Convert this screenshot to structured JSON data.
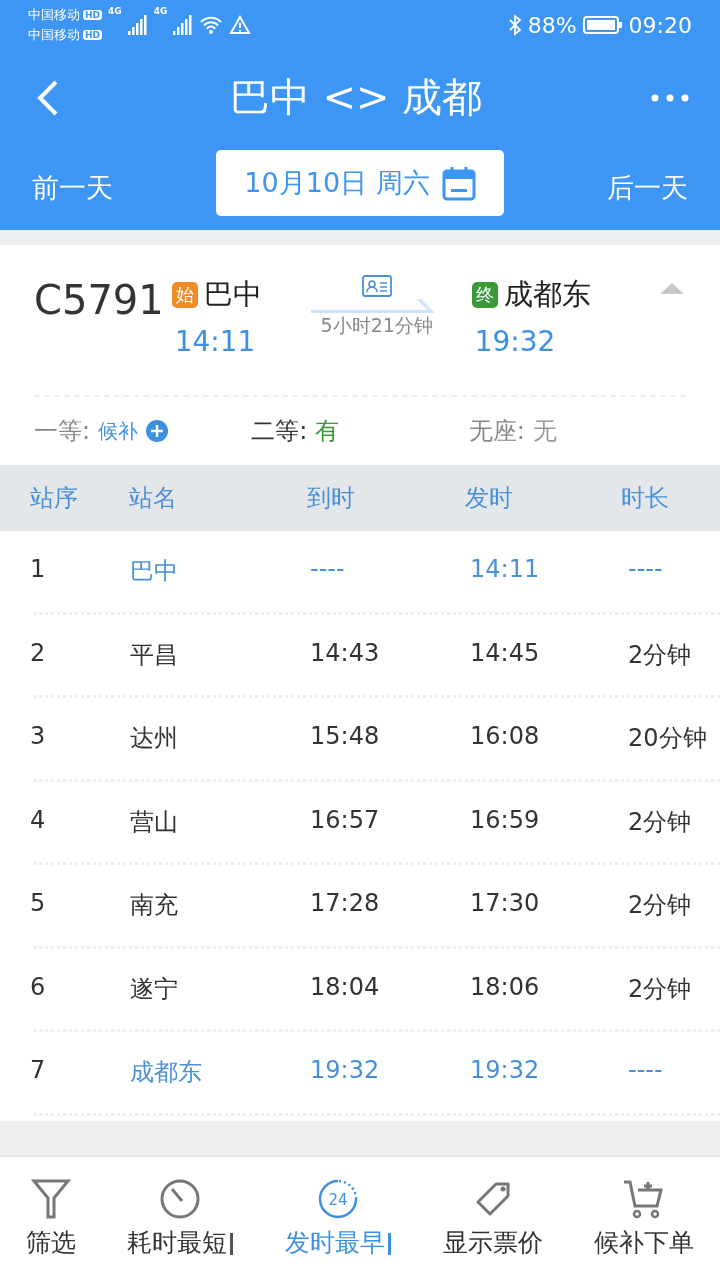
{
  "status_bar": {
    "carrier_1": "中国移动",
    "carrier_2": "中国移动",
    "hd_1": "HD",
    "hd_2": "HD",
    "net_1": "4G",
    "net_2": "4G",
    "battery": "88%",
    "time": "09:20"
  },
  "header": {
    "title": "巴中 <> 成都",
    "prev_day": "前一天",
    "date": "10月10日 周六",
    "next_day": "后一天"
  },
  "train": {
    "number": "C5791",
    "from_tag": "始",
    "from": "巴中",
    "depart": "14:11",
    "duration": "5小时21分钟",
    "to_tag": "终",
    "to": "成都东",
    "arrive": "19:32",
    "expanded": true
  },
  "seats": [
    {
      "label": "一等:",
      "value": "候补",
      "color": "#3d8fe0",
      "waitlist": true
    },
    {
      "label": "二等:",
      "value": "有",
      "color": "#3a9a3a",
      "waitlist": false
    },
    {
      "label": "无座:",
      "value": "无",
      "color": "#999999",
      "waitlist": false
    }
  ],
  "table": {
    "columns": [
      "站序",
      "站名",
      "到时",
      "发时",
      "时长"
    ],
    "rows": [
      {
        "cells": [
          "1",
          "巴中",
          "----",
          "14:11",
          "----"
        ],
        "highlighted": true
      },
      {
        "cells": [
          "2",
          "平昌",
          "14:43",
          "14:45",
          "2分钟"
        ],
        "highlighted": false
      },
      {
        "cells": [
          "3",
          "达州",
          "15:48",
          "16:08",
          "20分钟"
        ],
        "highlighted": false
      },
      {
        "cells": [
          "4",
          "营山",
          "16:57",
          "16:59",
          "2分钟"
        ],
        "highlighted": false
      },
      {
        "cells": [
          "5",
          "南充",
          "17:28",
          "17:30",
          "2分钟"
        ],
        "highlighted": false
      },
      {
        "cells": [
          "6",
          "遂宁",
          "18:04",
          "18:06",
          "2分钟"
        ],
        "highlighted": false
      },
      {
        "cells": [
          "7",
          "成都东",
          "19:32",
          "19:32",
          "----"
        ],
        "highlighted": true
      }
    ]
  },
  "bottom_bar": [
    {
      "kind": "filter",
      "label": "筛选",
      "selected": false
    },
    {
      "kind": "duration",
      "label": "耗时最短",
      "selected": false
    },
    {
      "kind": "depart",
      "label": "发时最早",
      "selected": true,
      "icon_text": "24"
    },
    {
      "kind": "price",
      "label": "显示票价",
      "selected": false
    },
    {
      "kind": "cart",
      "label": "候补下单",
      "selected": false
    }
  ]
}
